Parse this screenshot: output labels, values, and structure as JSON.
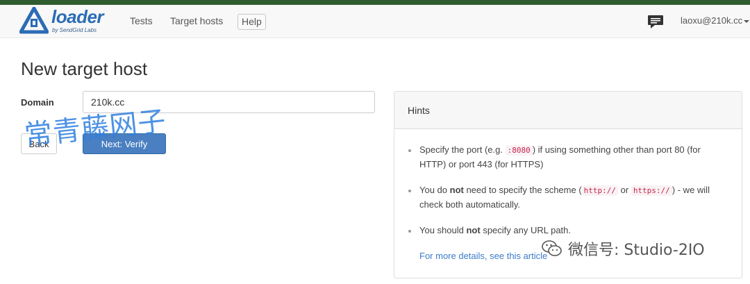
{
  "navbar": {
    "brand_name": "loader",
    "brand_sub": "by SendGrid Labs",
    "links": [
      {
        "label": "Tests"
      },
      {
        "label": "Target hosts"
      }
    ],
    "help_label": "Help",
    "user": "laoxu@210k.cc"
  },
  "page": {
    "title": "New target host"
  },
  "form": {
    "domain_label": "Domain",
    "domain_value": "210k.cc",
    "back_label": "Back",
    "next_label": "Next: Verify"
  },
  "hints": {
    "title": "Hints",
    "items": [
      {
        "pre": "Specify the port (e.g. ",
        "code": ":8080",
        "post": ") if using something other than port 80 (for HTTP) or port 443 (for HTTPS)"
      },
      {
        "pre": "You do ",
        "bold": "not",
        "mid": " need to specify the scheme (",
        "code1": "http://",
        "or": " or ",
        "code2": "https://",
        "post": ") - we will check both automatically."
      },
      {
        "pre": "You should ",
        "bold": "not",
        "post": " specify any URL path."
      }
    ],
    "link": "For more details, see this article"
  },
  "overlays": {
    "watermark_cn": "常青藤网子",
    "wechat_text": "微信号: Studio-2IO"
  },
  "colors": {
    "brand": "#2b6cb5",
    "primary_button": "#4a7fc1",
    "link": "#3a7bc8",
    "code_text": "#c7254e",
    "top_strip": "#2f5d2f"
  },
  "icons": [
    "loader-logo-icon",
    "chat-icon",
    "caret-down-icon",
    "wechat-icon"
  ]
}
